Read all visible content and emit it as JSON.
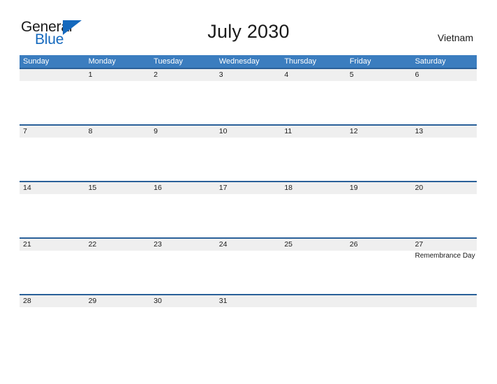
{
  "logo": {
    "word_top": "General",
    "word_bottom": "Blue",
    "triangle_icon": "triangle-icon",
    "brand_color": "#1569bd"
  },
  "header": {
    "title": "July 2030",
    "country": "Vietnam"
  },
  "theme": {
    "header_blue": "#3b7dbf",
    "row_rule_blue": "#2a6099",
    "band_gray": "#efefef",
    "text_dark": "#1a1a1a",
    "white": "#ffffff"
  },
  "calendar": {
    "weekdays": [
      "Sunday",
      "Monday",
      "Tuesday",
      "Wednesday",
      "Thursday",
      "Friday",
      "Saturday"
    ],
    "weeks": [
      {
        "days": [
          {
            "number": "",
            "event": ""
          },
          {
            "number": "1",
            "event": ""
          },
          {
            "number": "2",
            "event": ""
          },
          {
            "number": "3",
            "event": ""
          },
          {
            "number": "4",
            "event": ""
          },
          {
            "number": "5",
            "event": ""
          },
          {
            "number": "6",
            "event": ""
          }
        ]
      },
      {
        "days": [
          {
            "number": "7",
            "event": ""
          },
          {
            "number": "8",
            "event": ""
          },
          {
            "number": "9",
            "event": ""
          },
          {
            "number": "10",
            "event": ""
          },
          {
            "number": "11",
            "event": ""
          },
          {
            "number": "12",
            "event": ""
          },
          {
            "number": "13",
            "event": ""
          }
        ]
      },
      {
        "days": [
          {
            "number": "14",
            "event": ""
          },
          {
            "number": "15",
            "event": ""
          },
          {
            "number": "16",
            "event": ""
          },
          {
            "number": "17",
            "event": ""
          },
          {
            "number": "18",
            "event": ""
          },
          {
            "number": "19",
            "event": ""
          },
          {
            "number": "20",
            "event": ""
          }
        ]
      },
      {
        "days": [
          {
            "number": "21",
            "event": ""
          },
          {
            "number": "22",
            "event": ""
          },
          {
            "number": "23",
            "event": ""
          },
          {
            "number": "24",
            "event": ""
          },
          {
            "number": "25",
            "event": ""
          },
          {
            "number": "26",
            "event": ""
          },
          {
            "number": "27",
            "event": "Remembrance Day"
          }
        ]
      },
      {
        "days": [
          {
            "number": "28",
            "event": ""
          },
          {
            "number": "29",
            "event": ""
          },
          {
            "number": "30",
            "event": ""
          },
          {
            "number": "31",
            "event": ""
          },
          {
            "number": "",
            "event": ""
          },
          {
            "number": "",
            "event": ""
          },
          {
            "number": "",
            "event": ""
          }
        ]
      }
    ]
  }
}
